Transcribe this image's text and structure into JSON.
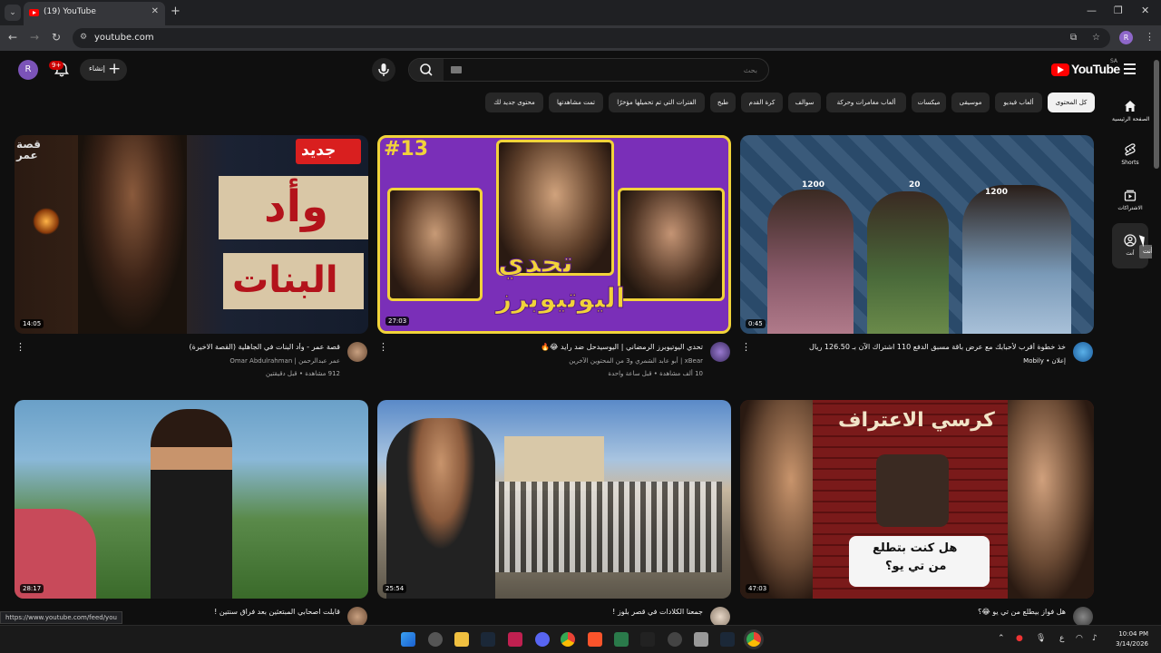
{
  "browser": {
    "tab_title": "(19) YouTube",
    "url": "youtube.com",
    "profile_initial": "R"
  },
  "header": {
    "avatar_initial": "R",
    "notification_count": "9+",
    "create_label": "إنشاء",
    "search_placeholder": "بحث",
    "logo_text": "YouTube",
    "country_code": "SA"
  },
  "chips": [
    {
      "label": "كل المحتوى",
      "active": true
    },
    {
      "label": "ألعاب فيديو",
      "active": false
    },
    {
      "label": "موسيقى",
      "active": false
    },
    {
      "label": "ميكسات",
      "active": false
    },
    {
      "label": "ألعاب مغامرات وحركة",
      "active": false
    },
    {
      "label": "سوالف",
      "active": false
    },
    {
      "label": "كرة القدم",
      "active": false
    },
    {
      "label": "طبخ",
      "active": false
    },
    {
      "label": "الفترات التي تم تحميلها مؤخرًا",
      "active": false
    },
    {
      "label": "تمت مشاهدتها",
      "active": false
    },
    {
      "label": "محتوى جديد لك",
      "active": false
    }
  ],
  "sidebar": [
    {
      "label": "الصفحة الرئيسية",
      "icon": "home-icon"
    },
    {
      "label": "Shorts",
      "icon": "shorts-icon"
    },
    {
      "label": "الاشتراكات",
      "icon": "subscriptions-icon"
    },
    {
      "label": "أنت",
      "icon": "you-icon"
    }
  ],
  "tooltip": "أنت",
  "videos": [
    {
      "title": "قصة عمر - وأد البنات في الجاهلية (القصة الاخيرة)",
      "channel": "عمر عبدالرحمن | Omar Abdulrahman",
      "stats": "912 مشاهدة • قبل دقيقتين",
      "duration": "14:05",
      "thumb_text_1": "جديد",
      "thumb_text_2": "وأد",
      "thumb_text_3": "البنات",
      "thumb_text_4": "قصة عمر"
    },
    {
      "title": "تحدي اليوتيوبرز الرمضاني | اليوسيدحل ضد رايد 😂🔥",
      "channel": "xBear | أبو عابد الشمري و3 من المحتوين الآخرين",
      "stats": "10 ألف مشاهدة • قبل ساعة واحدة",
      "duration": "27:03",
      "thumb_text_1": "#13",
      "thumb_text_2": "تحدي",
      "thumb_text_3": "اليوتيوبرز"
    },
    {
      "title": "خذ خطوة أقرب لأحبابك مع عرض باقة مسبق الدفع 110 اشتراك الآن بـ 126.50 ريال",
      "channel": "إعلان • Mobily",
      "stats": "",
      "duration": "0:45",
      "thumb_text_1": "1200",
      "thumb_text_2": "20",
      "thumb_text_3": "1200"
    },
    {
      "title": "قابلت اصحابي المبتعثين بعد فراق سنتين !",
      "channel": "",
      "stats": "",
      "duration": "28:17"
    },
    {
      "title": "جمعنا الكلادات في قصر بلوز !",
      "channel": "",
      "stats": "",
      "duration": "25:54"
    },
    {
      "title": "هل فواز بيطلع من تي يو 😂؟",
      "channel": "",
      "stats": "",
      "duration": "47:03",
      "thumb_text_1": "كرسي الاعتراف",
      "thumb_text_2": "هل كنت بتطلع",
      "thumb_text_3": "من تي يو؟"
    }
  ],
  "status_url": "https://www.youtube.com/feed/you",
  "taskbar": {
    "time": "10:04 PM",
    "date": "3/14/2026",
    "lang": "ع"
  },
  "colors": {
    "background": "#0f0f0f",
    "brand_red": "#ff0000",
    "chip_bg": "#272727"
  }
}
